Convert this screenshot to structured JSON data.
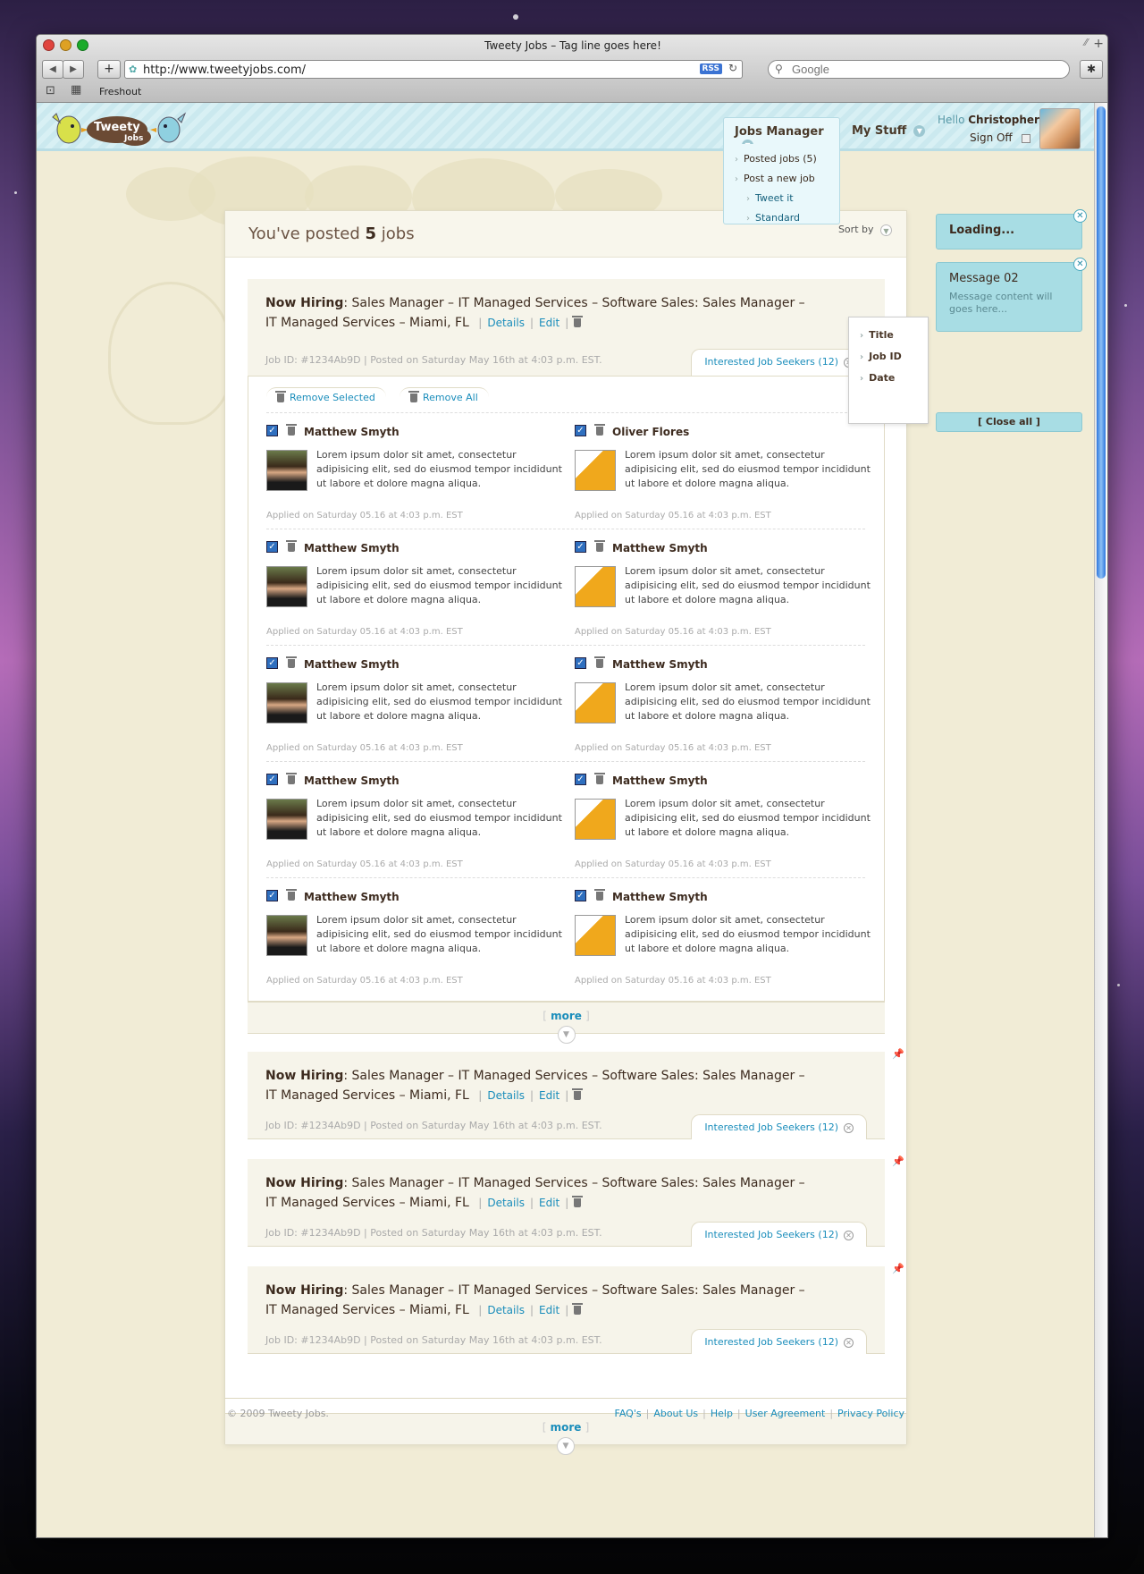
{
  "window": {
    "title": "Tweety Jobs – Tag line goes here!"
  },
  "browser": {
    "url": "http://www.tweetyjobs.com/",
    "rss_label": "RSS",
    "search_placeholder": "Google",
    "bookmark": "Freshout",
    "back_icon": "back-arrow-icon",
    "forward_icon": "forward-arrow-icon"
  },
  "header": {
    "logo_text": "Tweety Jobs",
    "nav": [
      {
        "label": "Jobs Manager"
      },
      {
        "label": "My Stuff"
      }
    ],
    "jobs_menu": [
      {
        "label": "Posted jobs (5)"
      },
      {
        "label": "Post a new job"
      },
      {
        "label": "Tweet it"
      },
      {
        "label": "Standard"
      }
    ],
    "greeting": "Hello",
    "username": "Christopher",
    "signoff": "Sign Off"
  },
  "panel": {
    "title_prefix": "You've posted",
    "count": "5",
    "title_suffix": "jobs",
    "sort_label": "Sort by",
    "sort_options": [
      "Title",
      "Job ID",
      "Date"
    ]
  },
  "job": {
    "prefix": "Now Hiring",
    "title": ": Sales Manager – IT Managed Services – Software Sales: Sales Manager – IT Managed Services – Miami, FL",
    "details": "Details",
    "edit": "Edit",
    "meta": "Job ID: #1234Ab9D  |  Posted on Saturday May 16th at 4:03 p.m. EST.",
    "interested": "Interested Job Seekers (12)"
  },
  "seekers": {
    "remove_selected": "Remove Selected",
    "remove_all": "Remove All",
    "bio": "Lorem ipsum dolor sit amet, consectetur adipisicing elit, sed do eiusmod tempor incididunt ut labore et dolore magna aliqua.",
    "applied": "Applied on Saturday 05.16 at 4:03 p.m. EST",
    "rows": [
      {
        "left": "Matthew Smyth",
        "right": "Oliver Flores"
      },
      {
        "left": "Matthew Smyth",
        "right": "Matthew Smyth"
      },
      {
        "left": "Matthew Smyth",
        "right": "Matthew Smyth"
      },
      {
        "left": "Matthew Smyth",
        "right": "Matthew Smyth"
      },
      {
        "left": "Matthew Smyth",
        "right": "Matthew Smyth"
      }
    ]
  },
  "more_label": "more",
  "notifications": [
    {
      "title": "Loading..."
    },
    {
      "title": "Message 02",
      "text": "Message content will goes here..."
    }
  ],
  "close_all": "[ Close all ]",
  "footer": {
    "copyright": "© 2009 Tweety Jobs.",
    "links": [
      "FAQ's",
      "About Us",
      "Help",
      "User Agreement",
      "Privacy Policy"
    ]
  },
  "colors": {
    "accent": "#1a8dbb",
    "header_bg": "#cbe9ef",
    "page_bg": "#f1ecd6",
    "notif_bg": "#a8dde4"
  }
}
